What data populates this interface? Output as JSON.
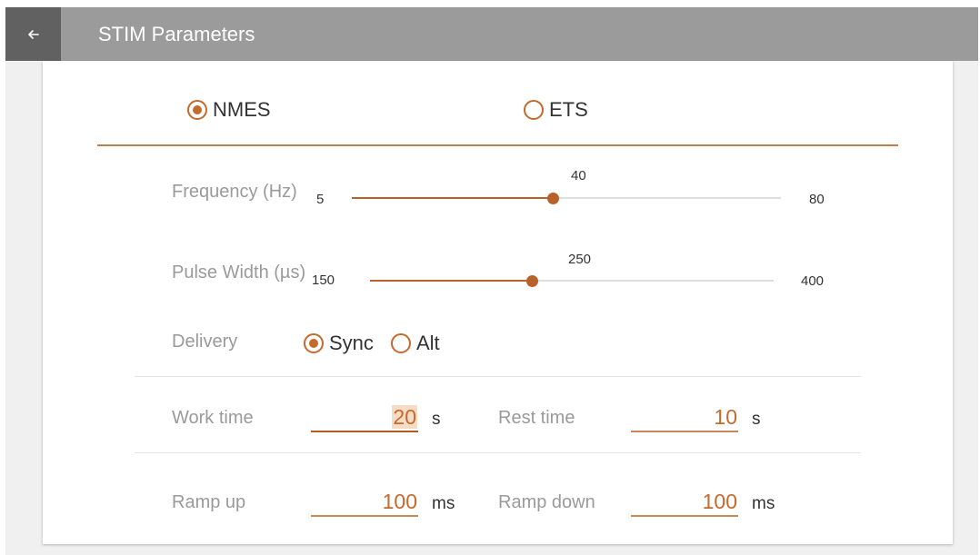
{
  "appbar": {
    "title": "STIM Parameters",
    "back_icon": "arrow-left-icon"
  },
  "colors": {
    "accent": "#c56a2d",
    "appbar": "#9b9b9b",
    "back_bg": "#616161"
  },
  "mode": {
    "options": [
      "NMES",
      "ETS"
    ],
    "selected": "NMES"
  },
  "frequency": {
    "label": "Frequency (Hz)",
    "min": "5",
    "max": "80",
    "value": "40",
    "fraction": 0.467
  },
  "pulse_width": {
    "label": "Pulse Width (µs)",
    "min": "150",
    "max": "400",
    "value": "250",
    "fraction": 0.4
  },
  "delivery": {
    "label": "Delivery",
    "options": [
      "Sync",
      "Alt"
    ],
    "selected": "Sync"
  },
  "work_time": {
    "label": "Work time",
    "value": "20",
    "unit": "s"
  },
  "rest_time": {
    "label": "Rest time",
    "value": "10",
    "unit": "s"
  },
  "ramp_up": {
    "label": "Ramp up",
    "value": "100",
    "unit": "ms"
  },
  "ramp_down": {
    "label": "Ramp down",
    "value": "100",
    "unit": "ms"
  }
}
